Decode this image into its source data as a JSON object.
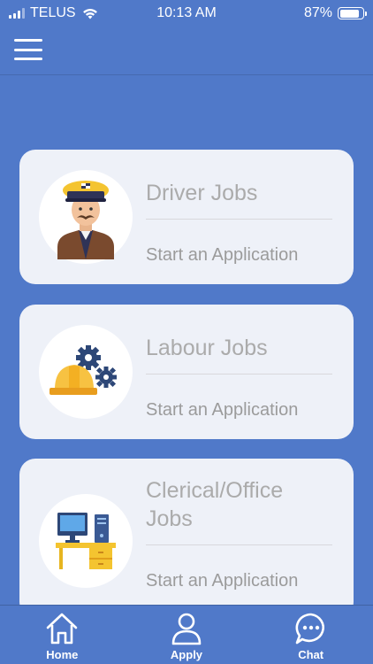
{
  "status_bar": {
    "carrier": "TELUS",
    "time": "10:13 AM",
    "battery": "87%",
    "battery_level": 0.87
  },
  "header": {
    "menu_icon": "hamburger-menu-icon"
  },
  "job_cards": [
    {
      "title": "Driver Jobs",
      "cta": "Start an Application",
      "icon": "driver-icon"
    },
    {
      "title": "Labour Jobs",
      "cta": "Start an Application",
      "icon": "hardhat-gears-icon"
    },
    {
      "title": "Clerical/Office Jobs",
      "cta": "Start an Application",
      "icon": "office-desk-icon"
    }
  ],
  "tab_bar": {
    "items": [
      {
        "label": "Home",
        "icon": "home-icon"
      },
      {
        "label": "Apply",
        "icon": "person-icon"
      },
      {
        "label": "Chat",
        "icon": "chat-icon"
      }
    ]
  },
  "colors": {
    "background": "#5079C9",
    "card": "#EEF1F8",
    "title_text": "#ABABAB",
    "cta_text": "#9B9B9B"
  }
}
